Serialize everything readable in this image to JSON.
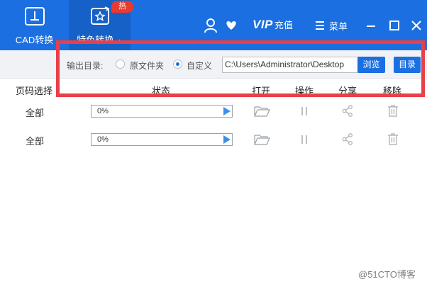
{
  "tabs": [
    {
      "label": "CAD转换",
      "icon": "cad-icon"
    },
    {
      "label": "特色转换",
      "icon": "special-convert-icon",
      "badge": "热"
    }
  ],
  "header_right": {
    "vip_text": "VIP",
    "vip_recharge": "充值",
    "menu_label": "菜单"
  },
  "settings": {
    "output_dir_label": "输出目录:",
    "radio_original": "原文件夹",
    "radio_custom": "自定义",
    "selected_radio": "custom",
    "path_value": "C:\\Users\\Administrator\\Desktop",
    "browse_label": "浏览",
    "dir_label": "目录"
  },
  "table": {
    "columns": [
      "页码选择",
      "状态",
      "打开",
      "操作",
      "分享",
      "移除"
    ],
    "rows": [
      {
        "pages": "全部",
        "progress": "0%"
      },
      {
        "pages": "全部",
        "progress": "0%"
      }
    ]
  },
  "watermark": "@51CTO博客",
  "colors": {
    "topbar": "#1b6fe0",
    "active_tab": "#1661c8",
    "badge": "#e93a2e",
    "highlight_frame": "#e84049"
  }
}
